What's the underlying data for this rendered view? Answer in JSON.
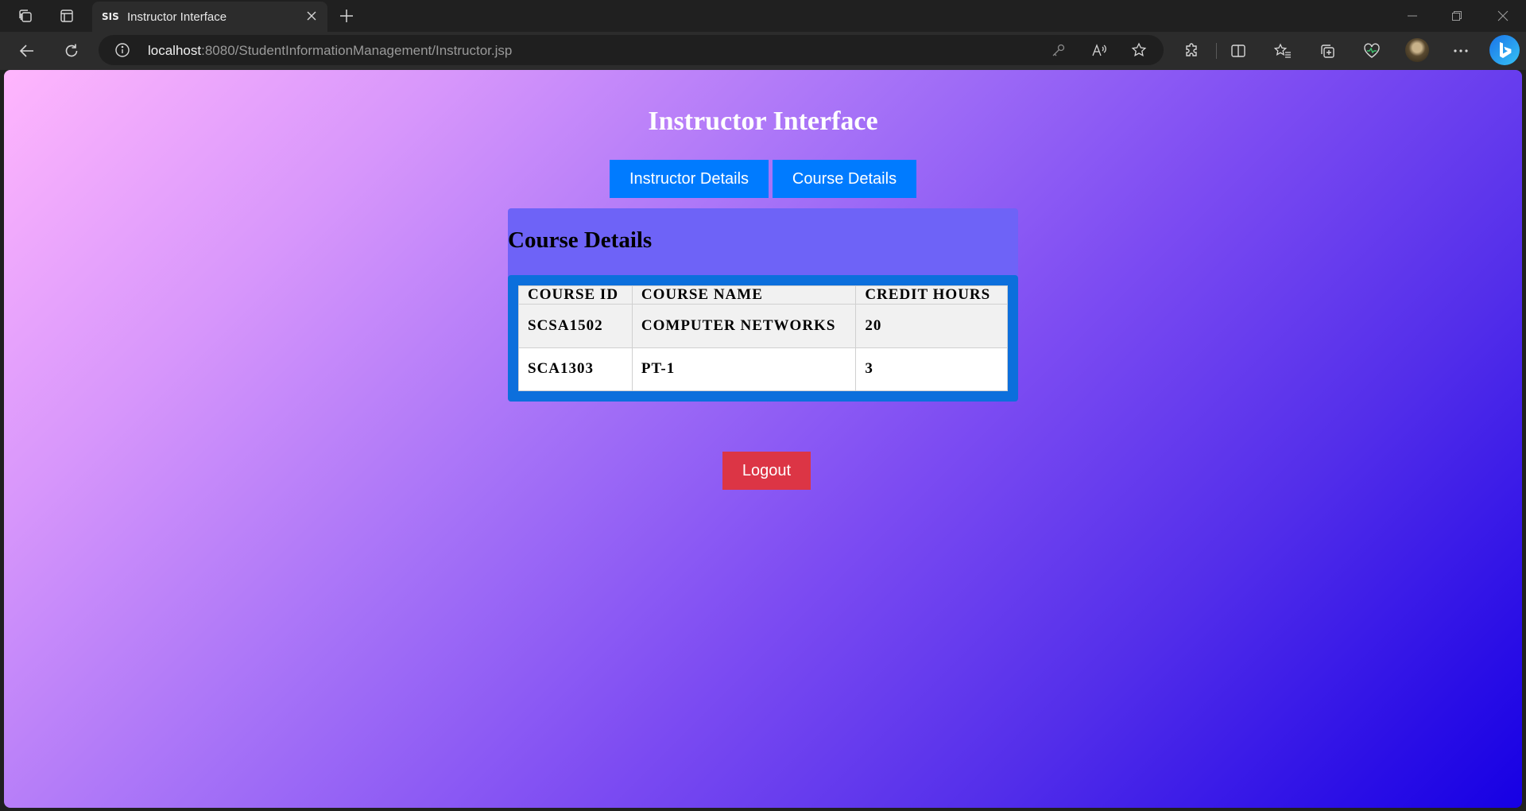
{
  "browser": {
    "tab": {
      "favicon_text": "SIS",
      "title": "Instructor Interface"
    },
    "url": {
      "host": "localhost",
      "rest": ":8080/StudentInformationManagement/Instructor.jsp"
    }
  },
  "page": {
    "title": "Instructor Interface",
    "nav": {
      "instructor_details": "Instructor Details",
      "course_details": "Course Details"
    },
    "panel": {
      "heading": "Course Details",
      "columns": [
        "COURSE ID",
        "COURSE NAME",
        "CREDIT HOURS"
      ],
      "rows": [
        [
          "SCSA1502",
          "COMPUTER NETWORKS",
          "20"
        ],
        [
          "SCA1303",
          "PT-1",
          "3"
        ]
      ]
    },
    "logout_label": "Logout"
  },
  "colors": {
    "button_blue": "#007bff",
    "logout_red": "#dc3545",
    "panel_bg": "#6e63f7",
    "table_frame": "#0c6fdc",
    "gradient_start": "#ffb6fd",
    "gradient_end": "#1600e4"
  }
}
